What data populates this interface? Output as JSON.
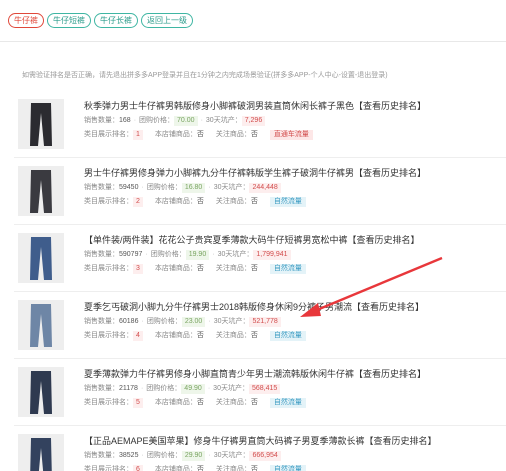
{
  "tags": [
    {
      "label": "牛仔裤",
      "active": true
    },
    {
      "label": "牛仔短裤",
      "active": false
    },
    {
      "label": "牛仔长裤",
      "active": false
    },
    {
      "label": "返回上一级",
      "active": false
    }
  ],
  "notice": "如需验证排名是否正确，请先退出拼多多APP登录并且在1分钟之内完成场景验证(拼多多APP-个人中心-设置-退出登录)",
  "labels": {
    "sales": "销售数量：",
    "group_price": "团购价格：",
    "sales_30d": "30天坑产：",
    "category_rank": "类目展示排名：",
    "own_shop": "本店铺商品：",
    "followed": "关注商品：",
    "history": "【查看历史排名】"
  },
  "products": [
    {
      "title": "秋季弹力男士牛仔裤男韩版修身小脚裤破洞男装直筒休闲长裤子黑色",
      "sales": "168",
      "price": "70.00",
      "revenue": "7,296",
      "rank": "1",
      "own_shop": "否",
      "followed": "否",
      "traffic": "直通车流量",
      "traffic_type": "paid",
      "thumb_color": "#2b2b30"
    },
    {
      "title": "男士牛仔裤男修身弹力小脚裤九分牛仔裤韩版学生裤子破洞牛仔裤男",
      "sales": "59450",
      "price": "16.80",
      "revenue": "244,448",
      "rank": "2",
      "own_shop": "否",
      "followed": "否",
      "traffic": "自然流量",
      "traffic_type": "natural",
      "thumb_color": "#3a3a40"
    },
    {
      "title": "【单件装/两件装】花花公子贵宾夏季薄款大码牛仔短裤男宽松中裤",
      "sales": "590797",
      "price": "19.90",
      "revenue": "1,799,941",
      "rank": "3",
      "own_shop": "否",
      "followed": "否",
      "traffic": "自然流量",
      "traffic_type": "natural",
      "thumb_color": "#3f5d8c"
    },
    {
      "title": "夏季乞丐破洞小脚九分牛仔裤男士2018韩版修身休闲9分裤子男潮流",
      "sales": "60186",
      "price": "23.00",
      "revenue": "521,778",
      "rank": "4",
      "own_shop": "否",
      "followed": "否",
      "traffic": "自然流量",
      "traffic_type": "natural",
      "thumb_color": "#6e86a6"
    },
    {
      "title": "夏季薄款弹力牛仔裤男修身小脚直筒青少年男士潮流韩版休闲牛仔裤",
      "sales": "21178",
      "price": "49.90",
      "revenue": "568,415",
      "rank": "5",
      "own_shop": "否",
      "followed": "否",
      "traffic": "自然流量",
      "traffic_type": "natural",
      "thumb_color": "#2f3a50"
    },
    {
      "title": "【正品AEMAPE美国苹果】修身牛仔裤男直筒大码裤子男夏季薄款长裤",
      "sales": "38525",
      "price": "29.90",
      "revenue": "666,954",
      "rank": "6",
      "own_shop": "否",
      "followed": "否",
      "traffic": "自然流量",
      "traffic_type": "natural",
      "thumb_color": "#33425e"
    }
  ]
}
